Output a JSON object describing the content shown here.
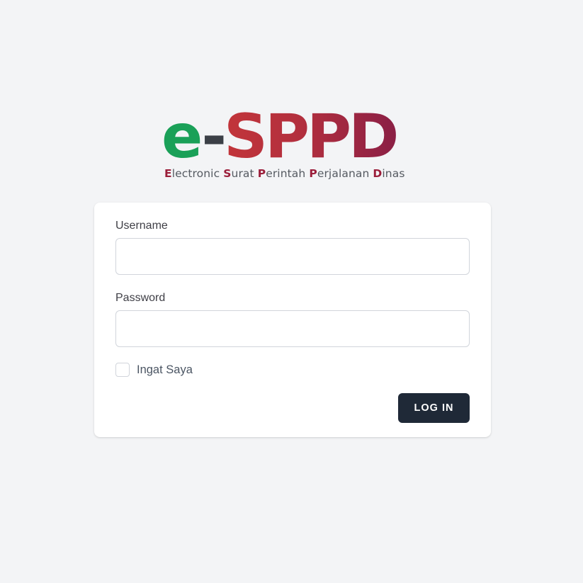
{
  "logo": {
    "e": "e",
    "dash": "-",
    "sppd": "SPPD",
    "subtitle_words": [
      {
        "cap": "E",
        "rest": "lectronic "
      },
      {
        "cap": "S",
        "rest": "urat "
      },
      {
        "cap": "P",
        "rest": "erintah "
      },
      {
        "cap": "P",
        "rest": "erjalanan "
      },
      {
        "cap": "D",
        "rest": "inas"
      }
    ]
  },
  "form": {
    "username_label": "Username",
    "username_value": "",
    "password_label": "Password",
    "password_value": "",
    "remember_label": "Ingat Saya",
    "remember_checked": false,
    "login_label": "LOG IN"
  },
  "colors": {
    "background": "#f3f4f6",
    "logo_green": "#1aa058",
    "logo_red": "#c2353a",
    "logo_maroon": "#8b1f45",
    "button": "#1f2937"
  }
}
